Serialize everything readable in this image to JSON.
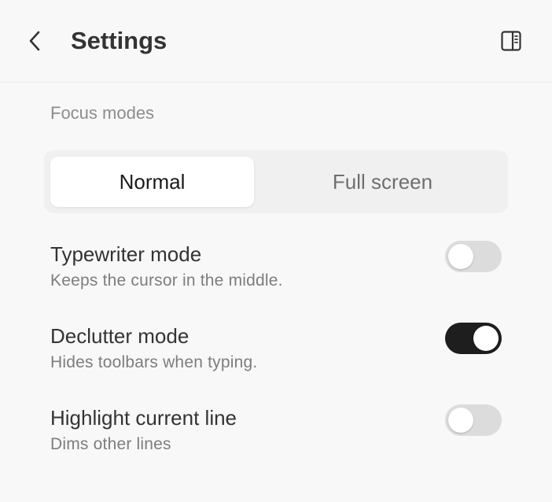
{
  "header": {
    "title": "Settings",
    "back_icon": "chevron-left-icon",
    "panel_icon": "sidebar-panel-icon"
  },
  "section": {
    "label": "Focus modes"
  },
  "segmented": {
    "options": [
      "Normal",
      "Full screen"
    ],
    "selected": "Normal"
  },
  "settings": [
    {
      "title": "Typewriter mode",
      "description": "Keeps the cursor in the middle.",
      "enabled": false
    },
    {
      "title": "Declutter mode",
      "description": "Hides toolbars when typing.",
      "enabled": true
    },
    {
      "title": "Highlight current line",
      "description": "Dims other lines",
      "enabled": false
    }
  ],
  "colors": {
    "background": "#f8f8f8",
    "toggle_on": "#1e1e1e",
    "toggle_off": "#dcdcdc"
  }
}
